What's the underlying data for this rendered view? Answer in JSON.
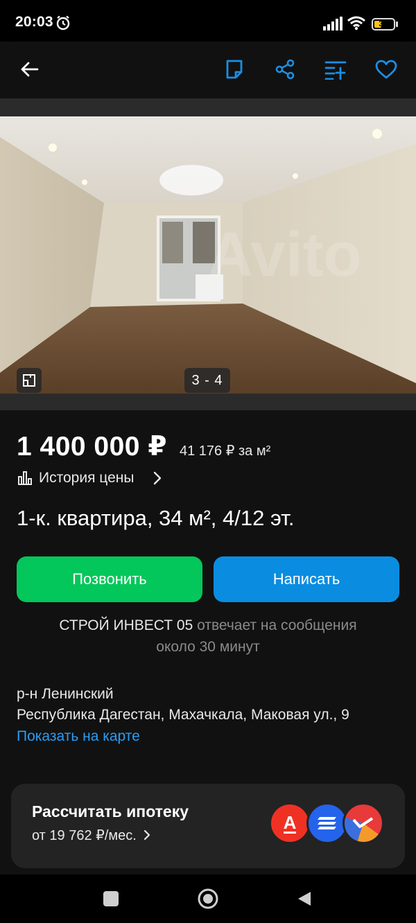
{
  "status_bar": {
    "time": "20:03",
    "battery": "33"
  },
  "header": {
    "icons": [
      "back-arrow-icon",
      "note-icon",
      "share-icon",
      "compare-icon",
      "heart-icon"
    ]
  },
  "gallery": {
    "counter": "3 - 4",
    "watermark": "Avito"
  },
  "listing": {
    "price": "1 400 000 ₽",
    "price_per_m2": "41 176 ₽ за м²",
    "price_history": "История цены",
    "title": "1-к. квартира, 34 м², 4/12 эт."
  },
  "actions": {
    "call": "Позвонить",
    "write": "Написать"
  },
  "seller": {
    "name": "СТРОЙ ИНВЕСТ 05",
    "reply_text": "отвечает на сообщения",
    "reply_time": "около 30 минут"
  },
  "location": {
    "district": "р-н Ленинский",
    "address": "Республика Дагестан, Махачкала, Маковая ул., 9",
    "map_link": "Показать на карте"
  },
  "mortgage": {
    "title": "Рассчитать ипотеку",
    "subtitle": "от 19 762 ₽/мес.",
    "banks": [
      {
        "letter": "А",
        "color": "#ef3124"
      },
      {
        "letter": "",
        "color": "#2463eb"
      },
      {
        "letter": "",
        "color": "#e83a3a"
      }
    ]
  },
  "colors": {
    "call_button": "#03c75a",
    "write_button": "#0a8de0",
    "link": "#2a9df4",
    "header_icons": "#1a8fe3"
  }
}
